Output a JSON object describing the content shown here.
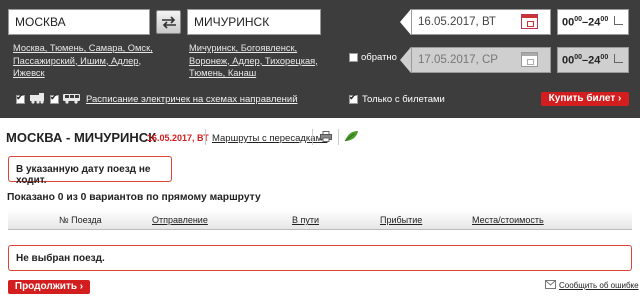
{
  "search": {
    "from_value": "МОСКВА",
    "to_value": "МИЧУРИНСК",
    "from_hint_line1": "Москва, Тюмень, Самара, Омск,",
    "from_hint_line2": "Пассажирский, Ишим, Адлер,",
    "from_hint_line3": "Ижевск",
    "to_hint_line1": "Мичуринск, Богоявленск,",
    "to_hint_line2": "Воронеж, Адлер, Тихорецкая,",
    "to_hint_line3": "Тюмень, Канаш",
    "date_there": "16.05.2017, ВТ",
    "date_back": "17.05.2017, СР",
    "time_there_from": "00",
    "time_there_from_sup": "00",
    "time_there_sep": "–",
    "time_there_to": "24",
    "time_there_to_sup": "00",
    "time_back_from": "00",
    "time_back_from_sup": "00",
    "time_back_sep": "–",
    "time_back_to": "24",
    "time_back_to_sup": "00",
    "return_label": "обратно",
    "return_checked": false,
    "train_checked": true,
    "bus_checked": true,
    "suburban_link": "Расписание электричек на схемах направлений",
    "only_tickets_label": "Только с билетами",
    "only_tickets_checked": true,
    "buy_button": "Купить билет ›"
  },
  "route": {
    "title": "МОСКВА - МИЧУРИНСК",
    "date": "16.05.2017, ВТ",
    "transfers_link": "Маршруты с пересадками"
  },
  "messages": {
    "no_train": "В указанную дату поезд не ходит.",
    "shown": "Показано 0 из 0 вариантов по прямому маршруту",
    "no_selection": "Не выбран поезд."
  },
  "table": {
    "col_train": "№ Поезда",
    "col_departure": "Отправление",
    "col_travel": "В пути",
    "col_arrival": "Прибытие",
    "col_seats": "Места/стоимость"
  },
  "footer": {
    "continue_button": "Продолжить ›",
    "report_link": "Сообщить об ошибке"
  },
  "colors": {
    "accent": "#d21e1e",
    "panel": "#3d3d3d"
  }
}
